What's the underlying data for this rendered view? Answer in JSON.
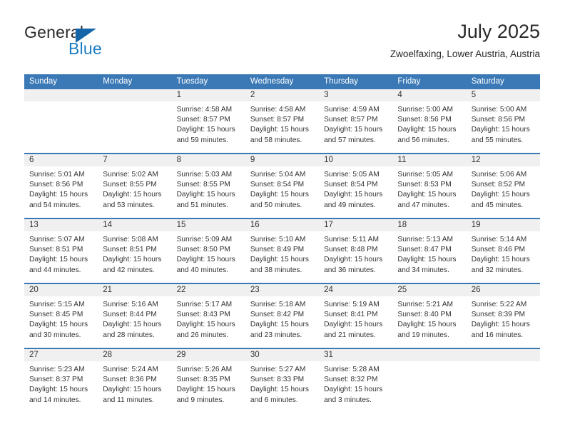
{
  "logo": {
    "word1": "General",
    "word2": "Blue",
    "triangle_color": "#1565a8",
    "blue_text_color": "#1b7ec4"
  },
  "header": {
    "title": "July 2025",
    "subtitle": "Zwoelfaxing, Lower Austria, Austria"
  },
  "theme": {
    "accent": "#3b79b6",
    "day_band": "#f0f0f0",
    "text": "#333333"
  },
  "weekdays": [
    "Sunday",
    "Monday",
    "Tuesday",
    "Wednesday",
    "Thursday",
    "Friday",
    "Saturday"
  ],
  "weeks": [
    [
      {
        "day": "",
        "empty": true
      },
      {
        "day": "",
        "empty": true
      },
      {
        "day": "1",
        "sunrise": "Sunrise: 4:58 AM",
        "sunset": "Sunset: 8:57 PM",
        "daylight1": "Daylight: 15 hours",
        "daylight2": "and 59 minutes."
      },
      {
        "day": "2",
        "sunrise": "Sunrise: 4:58 AM",
        "sunset": "Sunset: 8:57 PM",
        "daylight1": "Daylight: 15 hours",
        "daylight2": "and 58 minutes."
      },
      {
        "day": "3",
        "sunrise": "Sunrise: 4:59 AM",
        "sunset": "Sunset: 8:57 PM",
        "daylight1": "Daylight: 15 hours",
        "daylight2": "and 57 minutes."
      },
      {
        "day": "4",
        "sunrise": "Sunrise: 5:00 AM",
        "sunset": "Sunset: 8:56 PM",
        "daylight1": "Daylight: 15 hours",
        "daylight2": "and 56 minutes."
      },
      {
        "day": "5",
        "sunrise": "Sunrise: 5:00 AM",
        "sunset": "Sunset: 8:56 PM",
        "daylight1": "Daylight: 15 hours",
        "daylight2": "and 55 minutes."
      }
    ],
    [
      {
        "day": "6",
        "sunrise": "Sunrise: 5:01 AM",
        "sunset": "Sunset: 8:56 PM",
        "daylight1": "Daylight: 15 hours",
        "daylight2": "and 54 minutes."
      },
      {
        "day": "7",
        "sunrise": "Sunrise: 5:02 AM",
        "sunset": "Sunset: 8:55 PM",
        "daylight1": "Daylight: 15 hours",
        "daylight2": "and 53 minutes."
      },
      {
        "day": "8",
        "sunrise": "Sunrise: 5:03 AM",
        "sunset": "Sunset: 8:55 PM",
        "daylight1": "Daylight: 15 hours",
        "daylight2": "and 51 minutes."
      },
      {
        "day": "9",
        "sunrise": "Sunrise: 5:04 AM",
        "sunset": "Sunset: 8:54 PM",
        "daylight1": "Daylight: 15 hours",
        "daylight2": "and 50 minutes."
      },
      {
        "day": "10",
        "sunrise": "Sunrise: 5:05 AM",
        "sunset": "Sunset: 8:54 PM",
        "daylight1": "Daylight: 15 hours",
        "daylight2": "and 49 minutes."
      },
      {
        "day": "11",
        "sunrise": "Sunrise: 5:05 AM",
        "sunset": "Sunset: 8:53 PM",
        "daylight1": "Daylight: 15 hours",
        "daylight2": "and 47 minutes."
      },
      {
        "day": "12",
        "sunrise": "Sunrise: 5:06 AM",
        "sunset": "Sunset: 8:52 PM",
        "daylight1": "Daylight: 15 hours",
        "daylight2": "and 45 minutes."
      }
    ],
    [
      {
        "day": "13",
        "sunrise": "Sunrise: 5:07 AM",
        "sunset": "Sunset: 8:51 PM",
        "daylight1": "Daylight: 15 hours",
        "daylight2": "and 44 minutes."
      },
      {
        "day": "14",
        "sunrise": "Sunrise: 5:08 AM",
        "sunset": "Sunset: 8:51 PM",
        "daylight1": "Daylight: 15 hours",
        "daylight2": "and 42 minutes."
      },
      {
        "day": "15",
        "sunrise": "Sunrise: 5:09 AM",
        "sunset": "Sunset: 8:50 PM",
        "daylight1": "Daylight: 15 hours",
        "daylight2": "and 40 minutes."
      },
      {
        "day": "16",
        "sunrise": "Sunrise: 5:10 AM",
        "sunset": "Sunset: 8:49 PM",
        "daylight1": "Daylight: 15 hours",
        "daylight2": "and 38 minutes."
      },
      {
        "day": "17",
        "sunrise": "Sunrise: 5:11 AM",
        "sunset": "Sunset: 8:48 PM",
        "daylight1": "Daylight: 15 hours",
        "daylight2": "and 36 minutes."
      },
      {
        "day": "18",
        "sunrise": "Sunrise: 5:13 AM",
        "sunset": "Sunset: 8:47 PM",
        "daylight1": "Daylight: 15 hours",
        "daylight2": "and 34 minutes."
      },
      {
        "day": "19",
        "sunrise": "Sunrise: 5:14 AM",
        "sunset": "Sunset: 8:46 PM",
        "daylight1": "Daylight: 15 hours",
        "daylight2": "and 32 minutes."
      }
    ],
    [
      {
        "day": "20",
        "sunrise": "Sunrise: 5:15 AM",
        "sunset": "Sunset: 8:45 PM",
        "daylight1": "Daylight: 15 hours",
        "daylight2": "and 30 minutes."
      },
      {
        "day": "21",
        "sunrise": "Sunrise: 5:16 AM",
        "sunset": "Sunset: 8:44 PM",
        "daylight1": "Daylight: 15 hours",
        "daylight2": "and 28 minutes."
      },
      {
        "day": "22",
        "sunrise": "Sunrise: 5:17 AM",
        "sunset": "Sunset: 8:43 PM",
        "daylight1": "Daylight: 15 hours",
        "daylight2": "and 26 minutes."
      },
      {
        "day": "23",
        "sunrise": "Sunrise: 5:18 AM",
        "sunset": "Sunset: 8:42 PM",
        "daylight1": "Daylight: 15 hours",
        "daylight2": "and 23 minutes."
      },
      {
        "day": "24",
        "sunrise": "Sunrise: 5:19 AM",
        "sunset": "Sunset: 8:41 PM",
        "daylight1": "Daylight: 15 hours",
        "daylight2": "and 21 minutes."
      },
      {
        "day": "25",
        "sunrise": "Sunrise: 5:21 AM",
        "sunset": "Sunset: 8:40 PM",
        "daylight1": "Daylight: 15 hours",
        "daylight2": "and 19 minutes."
      },
      {
        "day": "26",
        "sunrise": "Sunrise: 5:22 AM",
        "sunset": "Sunset: 8:39 PM",
        "daylight1": "Daylight: 15 hours",
        "daylight2": "and 16 minutes."
      }
    ],
    [
      {
        "day": "27",
        "sunrise": "Sunrise: 5:23 AM",
        "sunset": "Sunset: 8:37 PM",
        "daylight1": "Daylight: 15 hours",
        "daylight2": "and 14 minutes."
      },
      {
        "day": "28",
        "sunrise": "Sunrise: 5:24 AM",
        "sunset": "Sunset: 8:36 PM",
        "daylight1": "Daylight: 15 hours",
        "daylight2": "and 11 minutes."
      },
      {
        "day": "29",
        "sunrise": "Sunrise: 5:26 AM",
        "sunset": "Sunset: 8:35 PM",
        "daylight1": "Daylight: 15 hours",
        "daylight2": "and 9 minutes."
      },
      {
        "day": "30",
        "sunrise": "Sunrise: 5:27 AM",
        "sunset": "Sunset: 8:33 PM",
        "daylight1": "Daylight: 15 hours",
        "daylight2": "and 6 minutes."
      },
      {
        "day": "31",
        "sunrise": "Sunrise: 5:28 AM",
        "sunset": "Sunset: 8:32 PM",
        "daylight1": "Daylight: 15 hours",
        "daylight2": "and 3 minutes."
      },
      {
        "day": "",
        "empty": true
      },
      {
        "day": "",
        "empty": true
      }
    ]
  ]
}
